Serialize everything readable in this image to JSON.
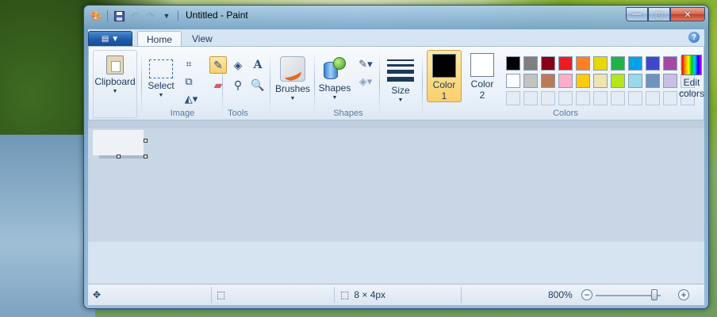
{
  "window": {
    "title": "Untitled - Paint"
  },
  "qat": {
    "icons": [
      "paint-app-icon",
      "save-icon",
      "undo-icon",
      "redo-icon",
      "customize-qat-icon"
    ]
  },
  "tabs": [
    {
      "label": "Home",
      "active": true
    },
    {
      "label": "View",
      "active": false
    }
  ],
  "ribbon": {
    "clipboard": {
      "label": "Clipboard"
    },
    "image": {
      "select_label": "Select",
      "group_label": "Image"
    },
    "tools": {
      "group_label": "Tools"
    },
    "brushes": {
      "label": "Brushes"
    },
    "shapes": {
      "button_label": "Shapes",
      "group_label": "Shapes"
    },
    "size": {
      "label": "Size"
    },
    "colors": {
      "color1_label": "Color",
      "color1_num": "1",
      "color2_label": "Color",
      "color2_num": "2",
      "edit_label_1": "Edit",
      "edit_label_2": "colors",
      "group_label": "Colors",
      "color1_value": "#000000",
      "color2_value": "#ffffff",
      "palette_row1": [
        "#000000",
        "#7f7f7f",
        "#880015",
        "#ed1c24",
        "#ff7f27",
        "#e6d800",
        "#22b14c",
        "#00a2e8",
        "#3f48cc",
        "#a349a4"
      ],
      "palette_row2": [
        "#ffffff",
        "#c3c3c3",
        "#b97a57",
        "#ffaec9",
        "#ffc90e",
        "#efe4b0",
        "#b5e61d",
        "#99d9ea",
        "#7092be",
        "#c8bfe7"
      ]
    }
  },
  "statusbar": {
    "image_size": "8 × 4px",
    "zoom": "800%",
    "zoom_fraction": 0.9
  }
}
